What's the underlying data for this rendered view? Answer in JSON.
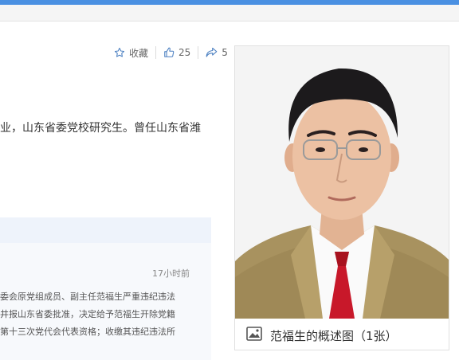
{
  "actions": {
    "favorite_label": "收藏",
    "like_count": "25",
    "share_count": "5"
  },
  "intro": {
    "text": "业，山东省委党校研究生。曾任山东省潍"
  },
  "news": {
    "time": "17小时前",
    "lines": [
      "委会原党组成员、副主任范福生严重违纪违法",
      "井报山东省委批准，决定给予范福生开除党籍",
      "第十三次党代会代表资格；收缴其违纪违法所"
    ]
  },
  "photo": {
    "caption": "范福生的概述图（1张）"
  },
  "colors": {
    "accent": "#4a90e2",
    "icon": "#4a7fc1",
    "tie": "#c8182a",
    "jacket": "#a8925f"
  }
}
